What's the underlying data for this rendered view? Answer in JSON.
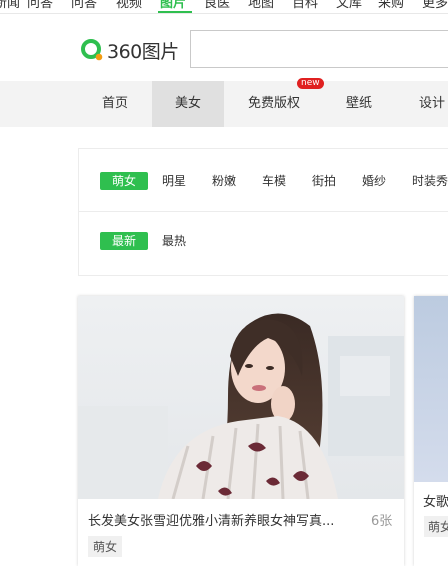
{
  "top_nav": {
    "items": [
      "新闻",
      "问答",
      "问答",
      "视频",
      "图片",
      "良医",
      "地图",
      "百科",
      "文库",
      "采购",
      "更多"
    ],
    "active_index": 4
  },
  "logo": {
    "text": "360图片",
    "brand_color": "#2fbf4f",
    "accent_color": "#f39c12"
  },
  "search": {
    "placeholder": ""
  },
  "categories": {
    "items": [
      "首页",
      "美女",
      "免费版权",
      "壁纸",
      "设计"
    ],
    "active_index": 1,
    "new_badge": "new"
  },
  "filters": {
    "subcategories": [
      "萌女",
      "明星",
      "粉嫩",
      "车模",
      "街拍",
      "婚纱",
      "时装秀"
    ],
    "sort": [
      "最新",
      "最热"
    ],
    "selected_sub": "萌女",
    "selected_sort": "最新"
  },
  "cards": [
    {
      "title": "长发美女张雪迎优雅小清新养眼女神写真...",
      "count": "6张",
      "tag": "萌女"
    },
    {
      "title": "女歌",
      "tag": "萌女"
    }
  ],
  "colors": {
    "accent": "#2fbf4f",
    "badge": "#e02020"
  }
}
